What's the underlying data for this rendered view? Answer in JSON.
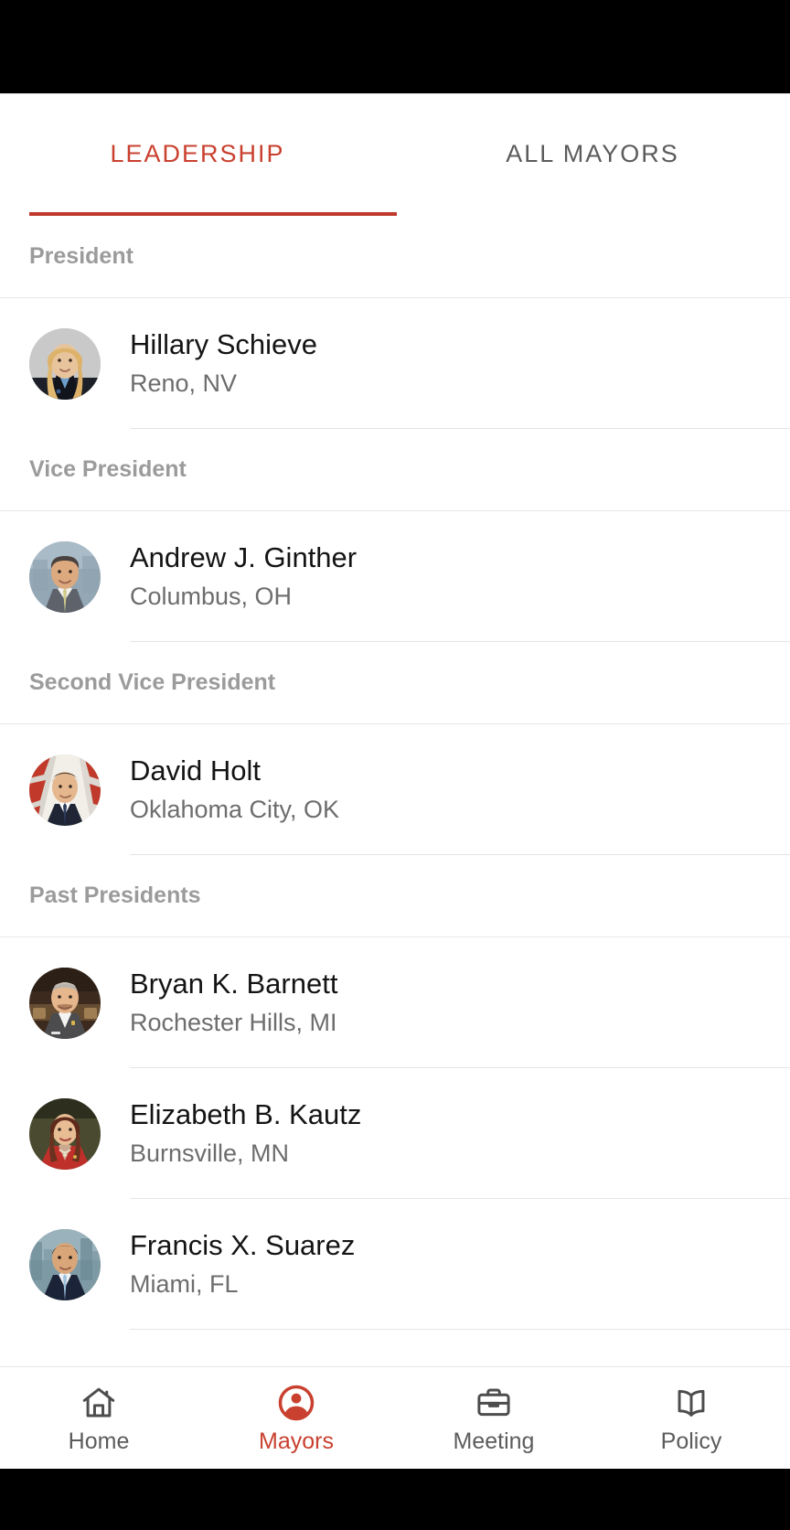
{
  "app": {
    "accent_color": "#c9402f",
    "indicator_color": "#c0392b",
    "muted_color": "#9b9b9b"
  },
  "tabs": [
    {
      "label": "LEADERSHIP",
      "active": true
    },
    {
      "label": "ALL MAYORS",
      "active": false
    }
  ],
  "sections": [
    {
      "header": "President",
      "rows": [
        {
          "name": "Hillary Schieve",
          "city": "Reno, NV",
          "avatar": "avatar-hillary-schieve"
        }
      ]
    },
    {
      "header": "Vice President",
      "rows": [
        {
          "name": "Andrew J. Ginther",
          "city": "Columbus, OH",
          "avatar": "avatar-andrew-ginther"
        }
      ]
    },
    {
      "header": "Second Vice President",
      "rows": [
        {
          "name": "David Holt",
          "city": "Oklahoma City, OK",
          "avatar": "avatar-david-holt"
        }
      ]
    },
    {
      "header": "Past Presidents",
      "rows": [
        {
          "name": "Bryan K. Barnett",
          "city": "Rochester Hills, MI",
          "avatar": "avatar-bryan-barnett"
        },
        {
          "name": "Elizabeth B. Kautz",
          "city": "Burnsville, MN",
          "avatar": "avatar-elizabeth-kautz"
        },
        {
          "name": "Francis X. Suarez",
          "city": "Miami, FL",
          "avatar": "avatar-francis-suarez"
        }
      ]
    }
  ],
  "bottom_nav": [
    {
      "label": "Home",
      "icon": "home-icon",
      "active": false
    },
    {
      "label": "Mayors",
      "icon": "account-circle-icon",
      "active": true
    },
    {
      "label": "Meeting",
      "icon": "briefcase-icon",
      "active": false
    },
    {
      "label": "Policy",
      "icon": "open-book-icon",
      "active": false
    }
  ]
}
